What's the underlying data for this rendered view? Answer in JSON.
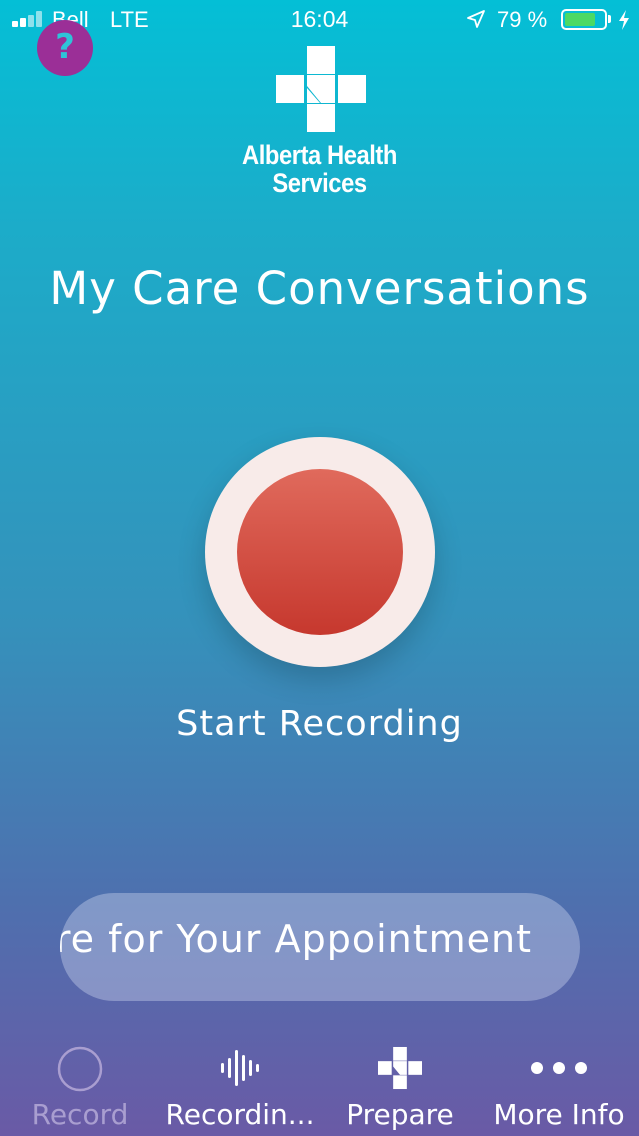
{
  "status_bar": {
    "carrier": "Bell",
    "network": "LTE",
    "time": "16:04",
    "battery_percent": "79 %",
    "battery_level": 0.79,
    "icons": [
      "signal-icon",
      "location-icon",
      "battery-icon",
      "charging-bolt-icon"
    ]
  },
  "help": {
    "label": "?",
    "icon": "help-icon",
    "color": "#9b2f97"
  },
  "logo": {
    "icon": "alberta-health-cross-logo",
    "line1": "Alberta Health",
    "line2": "Services"
  },
  "title": "My Care Conversations",
  "record": {
    "label": "Start Recording",
    "button_color": "#d2483c",
    "ring_color": "#f8ebe9"
  },
  "prepare_banner": {
    "text": "Prepare for Your Appointment"
  },
  "tabs": [
    {
      "label": "Record",
      "icon": "record-circle-icon",
      "active": true
    },
    {
      "label": "Recordin...",
      "icon": "waveform-icon",
      "active": false
    },
    {
      "label": "Prepare",
      "icon": "health-cross-icon",
      "active": false
    },
    {
      "label": "More Info",
      "icon": "more-dots-icon",
      "active": false
    }
  ]
}
